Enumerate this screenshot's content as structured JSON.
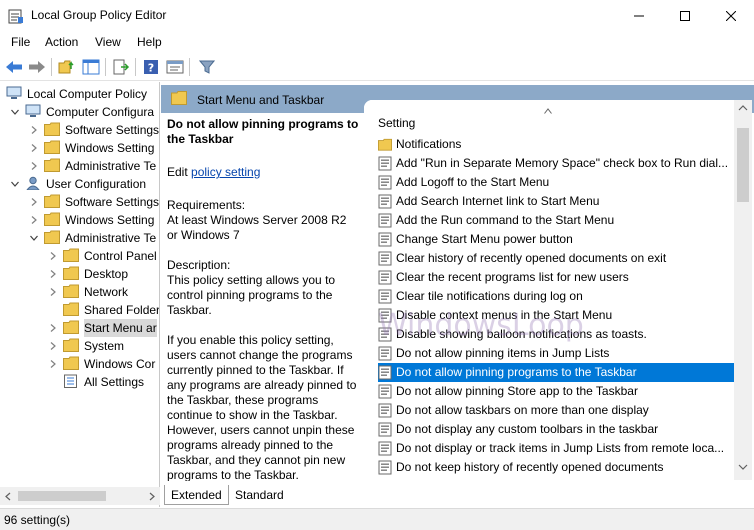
{
  "window": {
    "title": "Local Group Policy Editor"
  },
  "menu": [
    "File",
    "Action",
    "View",
    "Help"
  ],
  "tree": [
    {
      "label": "Local Computer Policy",
      "icon": "computer-icon",
      "level": 0,
      "expander": "none"
    },
    {
      "label": "Computer Configura",
      "icon": "computer-icon",
      "level": 1,
      "expander": "expanded"
    },
    {
      "label": "Software Settings",
      "icon": "folder-icon",
      "level": 2,
      "expander": "collapsed"
    },
    {
      "label": "Windows Setting",
      "icon": "folder-icon",
      "level": 2,
      "expander": "collapsed"
    },
    {
      "label": "Administrative Te",
      "icon": "folder-icon",
      "level": 2,
      "expander": "collapsed"
    },
    {
      "label": "User Configuration",
      "icon": "user-icon",
      "level": 1,
      "expander": "expanded"
    },
    {
      "label": "Software Settings",
      "icon": "folder-icon",
      "level": 2,
      "expander": "collapsed"
    },
    {
      "label": "Windows Setting",
      "icon": "folder-icon",
      "level": 2,
      "expander": "collapsed"
    },
    {
      "label": "Administrative Te",
      "icon": "folder-icon",
      "level": 2,
      "expander": "expanded"
    },
    {
      "label": "Control Panel",
      "icon": "folder-icon",
      "level": 3,
      "expander": "collapsed"
    },
    {
      "label": "Desktop",
      "icon": "folder-icon",
      "level": 3,
      "expander": "collapsed"
    },
    {
      "label": "Network",
      "icon": "folder-icon",
      "level": 3,
      "expander": "collapsed"
    },
    {
      "label": "Shared Folder",
      "icon": "folder-icon",
      "level": 3,
      "expander": "none"
    },
    {
      "label": "Start Menu ar",
      "icon": "folder-icon",
      "level": 3,
      "expander": "collapsed",
      "selected": true
    },
    {
      "label": "System",
      "icon": "folder-icon",
      "level": 3,
      "expander": "collapsed"
    },
    {
      "label": "Windows Cor",
      "icon": "folder-icon",
      "level": 3,
      "expander": "collapsed"
    },
    {
      "label": "All Settings",
      "icon": "settings-list-icon",
      "level": 3,
      "expander": "none"
    }
  ],
  "header": {
    "title": "Start Menu and Taskbar"
  },
  "description": {
    "title": "Do not allow pinning programs to the Taskbar",
    "edit_prefix": "Edit ",
    "edit_link": "policy setting ",
    "requirements_label": "Requirements:",
    "requirements_text": "At least Windows Server 2008 R2 or Windows 7",
    "description_label": "Description:",
    "description_text": "This policy setting allows you to control pinning programs to the Taskbar.",
    "enable_text": "If you enable this policy setting, users cannot change the programs currently pinned to the Taskbar. If any programs are already pinned to the Taskbar, these programs continue to show in the Taskbar. However, users cannot unpin these programs already pinned to the Taskbar, and they cannot pin new programs to the Taskbar."
  },
  "list": {
    "column": "Setting",
    "rows": [
      {
        "label": "Notifications",
        "icon": "folder-icon"
      },
      {
        "label": "Add \"Run in Separate Memory Space\" check box to Run dial...",
        "icon": "policy-icon"
      },
      {
        "label": "Add Logoff to the Start Menu",
        "icon": "policy-icon"
      },
      {
        "label": "Add Search Internet link to Start Menu",
        "icon": "policy-icon"
      },
      {
        "label": "Add the Run command to the Start Menu",
        "icon": "policy-icon"
      },
      {
        "label": "Change Start Menu power button",
        "icon": "policy-icon"
      },
      {
        "label": "Clear history of recently opened documents on exit",
        "icon": "policy-icon"
      },
      {
        "label": "Clear the recent programs list for new users",
        "icon": "policy-icon"
      },
      {
        "label": "Clear tile notifications during log on",
        "icon": "policy-icon"
      },
      {
        "label": "Disable context menus in the Start Menu",
        "icon": "policy-icon"
      },
      {
        "label": "Disable showing balloon notifications as toasts.",
        "icon": "policy-icon"
      },
      {
        "label": "Do not allow pinning items in Jump Lists",
        "icon": "policy-icon"
      },
      {
        "label": "Do not allow pinning programs to the Taskbar",
        "icon": "policy-icon",
        "selected": true
      },
      {
        "label": "Do not allow pinning Store app to the Taskbar",
        "icon": "policy-icon"
      },
      {
        "label": "Do not allow taskbars on more than one display",
        "icon": "policy-icon"
      },
      {
        "label": "Do not display any custom toolbars in the taskbar",
        "icon": "policy-icon"
      },
      {
        "label": "Do not display or track items in Jump Lists from remote loca...",
        "icon": "policy-icon"
      },
      {
        "label": "Do not keep history of recently opened documents",
        "icon": "policy-icon"
      }
    ]
  },
  "watermark": "WindowsLoop",
  "tabs": [
    "Extended",
    "Standard"
  ],
  "status": "96 setting(s)",
  "colors": {
    "selection": "#0078d7",
    "header_bar": "#8ca9c8",
    "folder": "#f0c850"
  }
}
